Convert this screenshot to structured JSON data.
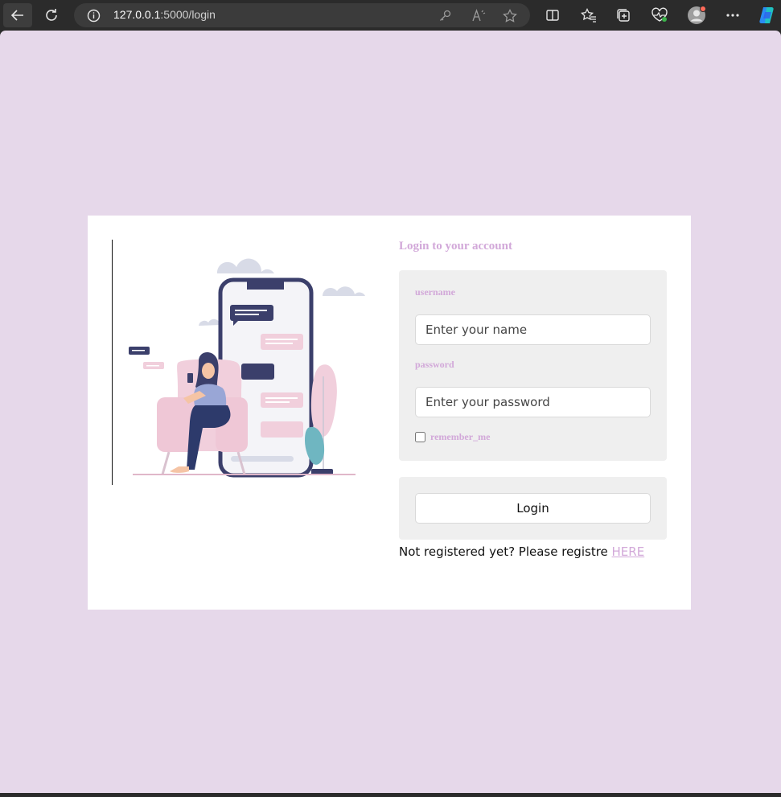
{
  "browser": {
    "url_host": "127.0.0.1",
    "url_path": ":5000/login"
  },
  "login": {
    "title": "Login to your account",
    "username_label": "username",
    "username_placeholder": "Enter your name",
    "password_label": "password",
    "password_placeholder": "Enter your password",
    "remember_label": "remember_me",
    "login_button": "Login",
    "register_text": "Not registered yet? Please registre ",
    "register_link": "HERE"
  },
  "colors": {
    "page_bg": "#e6d8ea",
    "accent": "#d2a8d9",
    "phone_frame": "#3b3f6b",
    "chair_pink": "#f1cfdc"
  },
  "icons": [
    "back-arrow-icon",
    "refresh-icon",
    "info-icon",
    "key-icon",
    "read-aloud-icon",
    "star-icon",
    "split-screen-icon",
    "favorites-icon",
    "collections-icon",
    "health-icon",
    "profile-icon",
    "more-icon",
    "copilot-icon"
  ]
}
